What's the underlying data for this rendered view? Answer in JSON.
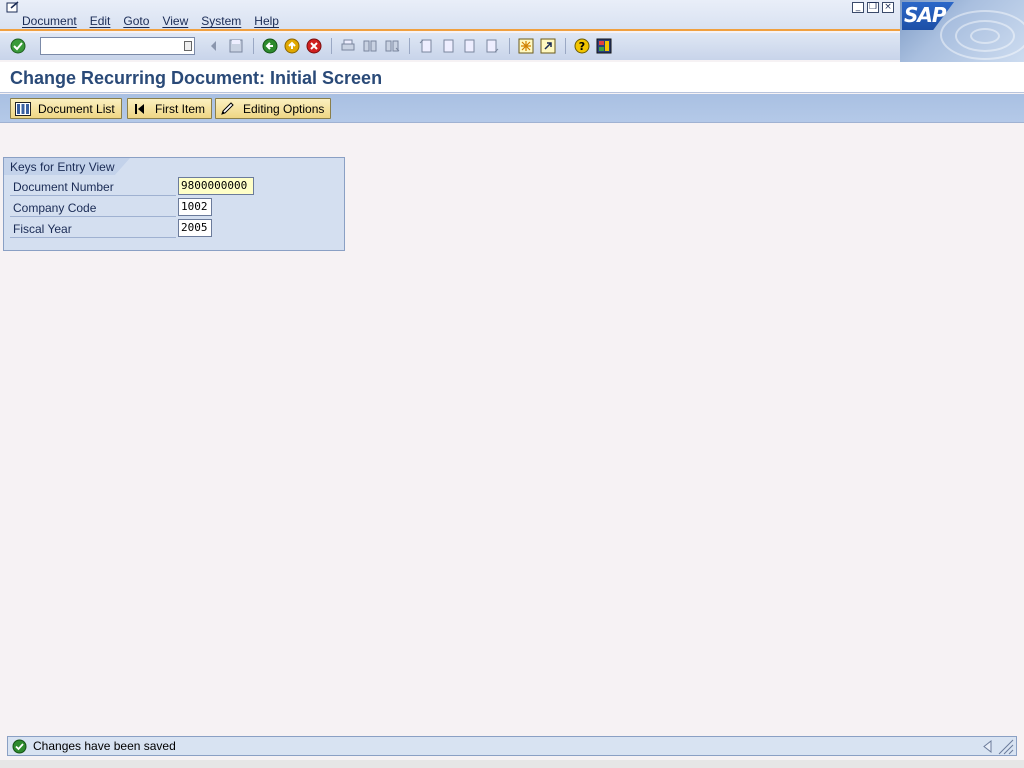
{
  "menu": {
    "items": [
      "Document",
      "Edit",
      "Goto",
      "View",
      "System",
      "Help"
    ]
  },
  "window_controls": {
    "minimize": "_",
    "restore": "❐",
    "close": "×"
  },
  "logo": {
    "text": "SAP"
  },
  "toolbar": {
    "command_field_value": "",
    "icons": [
      "enter-icon",
      "command-history-icon",
      "back-arrow-icon",
      "save-icon",
      "back-icon",
      "exit-icon",
      "cancel-icon",
      "print-icon",
      "find-icon",
      "find-next-icon",
      "first-page-icon",
      "previous-page-icon",
      "next-page-icon",
      "last-page-icon",
      "create-session-icon",
      "create-shortcut-icon",
      "help-icon",
      "customize-layout-icon"
    ]
  },
  "title": "Change Recurring Document: Initial Screen",
  "app_toolbar": {
    "document_list": "Document List",
    "first_item": "First Item",
    "editing_options": "Editing Options"
  },
  "group_box": {
    "title": "Keys for Entry View",
    "fields": [
      {
        "label": "Document Number",
        "value": "9800000000"
      },
      {
        "label": "Company Code",
        "value": "1002"
      },
      {
        "label": "Fiscal Year",
        "value": "2005"
      }
    ]
  },
  "status": {
    "message": "Changes have been saved"
  },
  "colors": {
    "title": "#2a4a78",
    "accent_orange": "#f0a040",
    "button_bg": "#efd684",
    "status_ok_green": "#2e8b2e"
  }
}
